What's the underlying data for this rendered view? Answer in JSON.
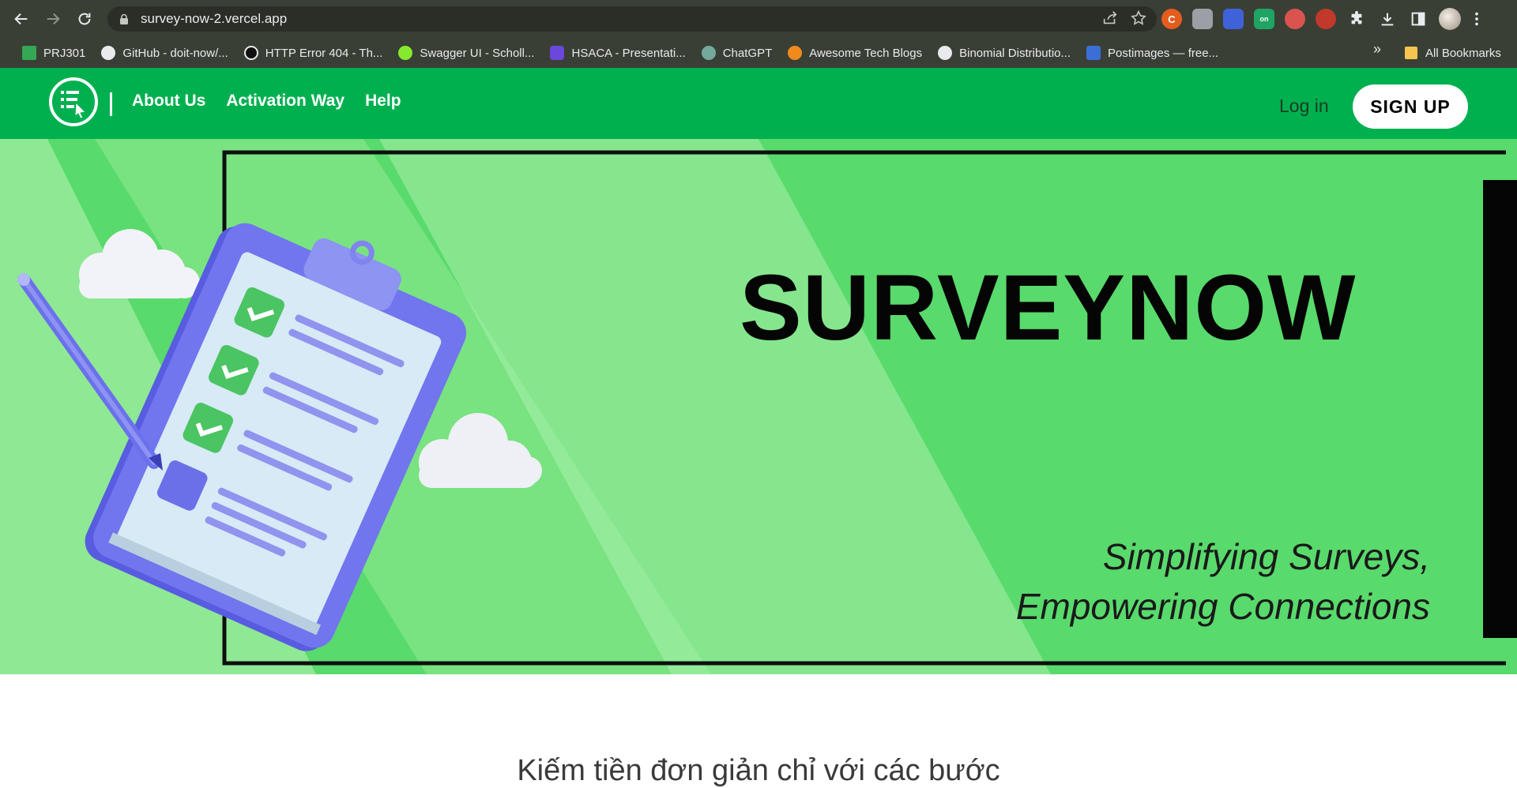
{
  "browser": {
    "url": "survey-now-2.vercel.app",
    "bookmarks": [
      {
        "label": "PRJ301",
        "icon": "drive-icon",
        "color": "#34a853"
      },
      {
        "label": "GitHub - doit-now/...",
        "icon": "github-icon",
        "color": "#e8eaed"
      },
      {
        "label": "HTTP Error 404 - Th...",
        "icon": "error-page-icon",
        "color": "#111111"
      },
      {
        "label": "Swagger UI - Scholl...",
        "icon": "swagger-icon",
        "color": "#85ea2d"
      },
      {
        "label": "HSACA - Presentati...",
        "icon": "hsaca-icon",
        "color": "#6b47dc"
      },
      {
        "label": "ChatGPT",
        "icon": "chatgpt-icon",
        "color": "#74aa9c"
      },
      {
        "label": "Awesome Tech Blogs",
        "icon": "bolt-icon",
        "color": "#f08a1c"
      },
      {
        "label": "Binomial Distributio...",
        "icon": "globe-icon",
        "color": "#e8eaed"
      },
      {
        "label": "Postimages — free...",
        "icon": "postimages-icon",
        "color": "#3b6fd8"
      }
    ],
    "bookmarks_more": "»",
    "all_bookmarks": "All Bookmarks"
  },
  "site": {
    "nav": {
      "about": "About Us",
      "activation": "Activation Way",
      "help": "Help",
      "login": "Log in",
      "signup": "SIGN UP"
    },
    "hero": {
      "title": "SURVEYNOW",
      "tagline_line1": "Simplifying Surveys,",
      "tagline_line2": "Empowering Connections"
    },
    "steps_heading": "Kiếm tiền đơn giản chỉ với các bước"
  },
  "colors": {
    "brand_green": "#00b04f",
    "hero_green": "#59da6c",
    "clipboard_purple": "#6f73ea"
  }
}
